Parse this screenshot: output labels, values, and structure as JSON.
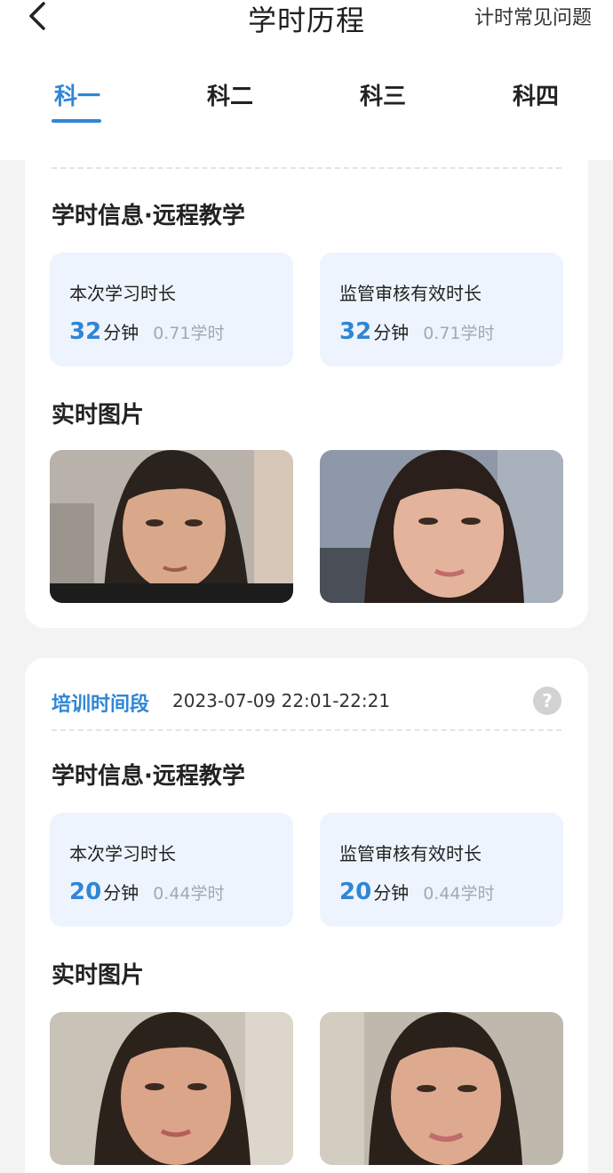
{
  "header": {
    "title": "学时历程",
    "faq_link": "计时常见问题",
    "back_icon": "chevron-left-icon"
  },
  "tabs": [
    {
      "label": "科一",
      "active": true
    },
    {
      "label": "科二",
      "active": false
    },
    {
      "label": "科三",
      "active": false
    },
    {
      "label": "科四",
      "active": false
    }
  ],
  "colors": {
    "accent": "#2f86d6",
    "stat_bg": "#eef4fd",
    "muted": "#a3a8b0"
  },
  "records": [
    {
      "section_title": "学时信息·远程教学",
      "stats": [
        {
          "label": "本次学习时长",
          "value": "32",
          "unit": "分钟",
          "hours": "0.71学时"
        },
        {
          "label": "监管审核有效时长",
          "value": "32",
          "unit": "分钟",
          "hours": "0.71学时"
        }
      ],
      "photos_title": "实时图片"
    },
    {
      "period_label": "培训时间段",
      "period_value": "2023-07-09 22:01-22:21",
      "help_icon": "question-mark-icon",
      "help_symbol": "?",
      "section_title": "学时信息·远程教学",
      "stats": [
        {
          "label": "本次学习时长",
          "value": "20",
          "unit": "分钟",
          "hours": "0.44学时"
        },
        {
          "label": "监管审核有效时长",
          "value": "20",
          "unit": "分钟",
          "hours": "0.44学时"
        }
      ],
      "photos_title": "实时图片"
    }
  ]
}
